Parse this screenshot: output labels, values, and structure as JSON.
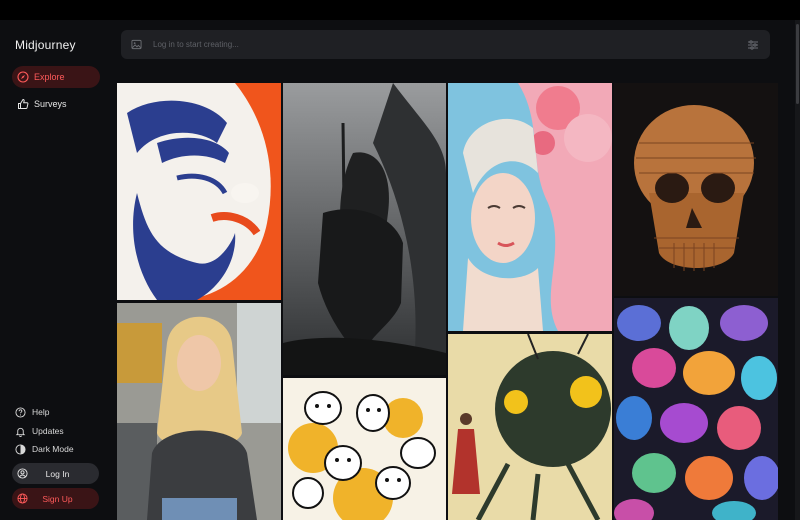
{
  "app": {
    "brand": "Midjourney"
  },
  "nav": {
    "explore": "Explore",
    "surveys": "Surveys"
  },
  "footer": {
    "help": "Help",
    "updates": "Updates",
    "dark_mode": "Dark Mode",
    "log_in": "Log In",
    "sign_up": "Sign Up"
  },
  "search": {
    "placeholder": "Log in to start creating..."
  },
  "gallery": {
    "items": [
      {
        "subject": "stylized mask face in orange, blue and white"
      },
      {
        "subject": "dark knight on horseback in rain"
      },
      {
        "subject": "rococo portrait with pink flowers"
      },
      {
        "subject": "bronze layered skull"
      },
      {
        "subject": "young woman with blonde hair in office"
      },
      {
        "subject": "doodle crowd of cartoon faces"
      },
      {
        "subject": "giant insect creature with woman in red dress"
      },
      {
        "subject": "glowing colorful gemstones"
      }
    ]
  },
  "colors": {
    "accent": "#ff5a5a",
    "accent_bg": "#3a1416",
    "sidebar_bg": "#0d0e11",
    "search_bg": "#1f2024"
  }
}
